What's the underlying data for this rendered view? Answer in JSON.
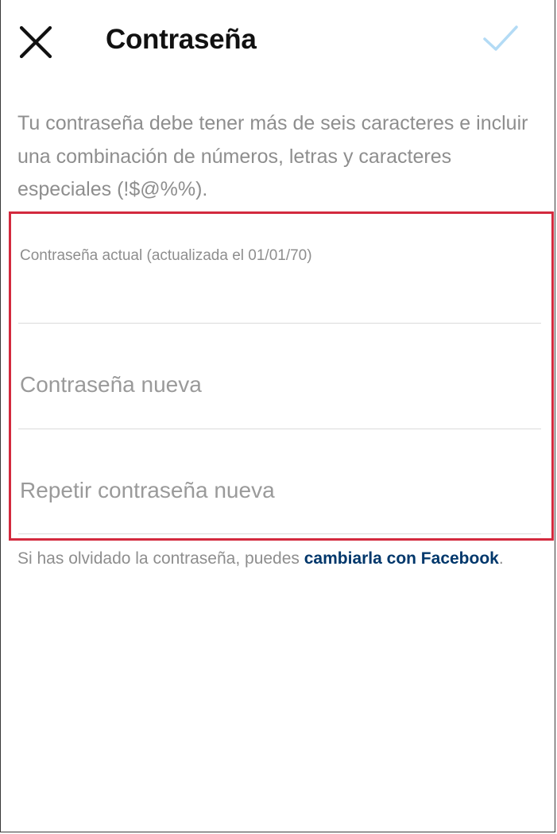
{
  "header": {
    "title": "Contraseña",
    "close_icon": "close-icon",
    "confirm_icon": "checkmark-icon",
    "confirm_color": "#b3dbf5"
  },
  "description": "Tu contraseña debe tener más de seis caracteres e incluir una combinación de números, letras y caracteres especiales (!$@%%).",
  "form": {
    "current_password_label": "Contraseña actual (actualizada el 01/01/70)",
    "current_password_value": "",
    "new_password_placeholder": "Contraseña nueva",
    "repeat_password_placeholder": "Repetir contraseña nueva",
    "highlight_color": "#d32a3e"
  },
  "forgot": {
    "text": "Si has olvidado la contraseña, puedes ",
    "link": "cambiarla con Facebook",
    "suffix": "."
  }
}
